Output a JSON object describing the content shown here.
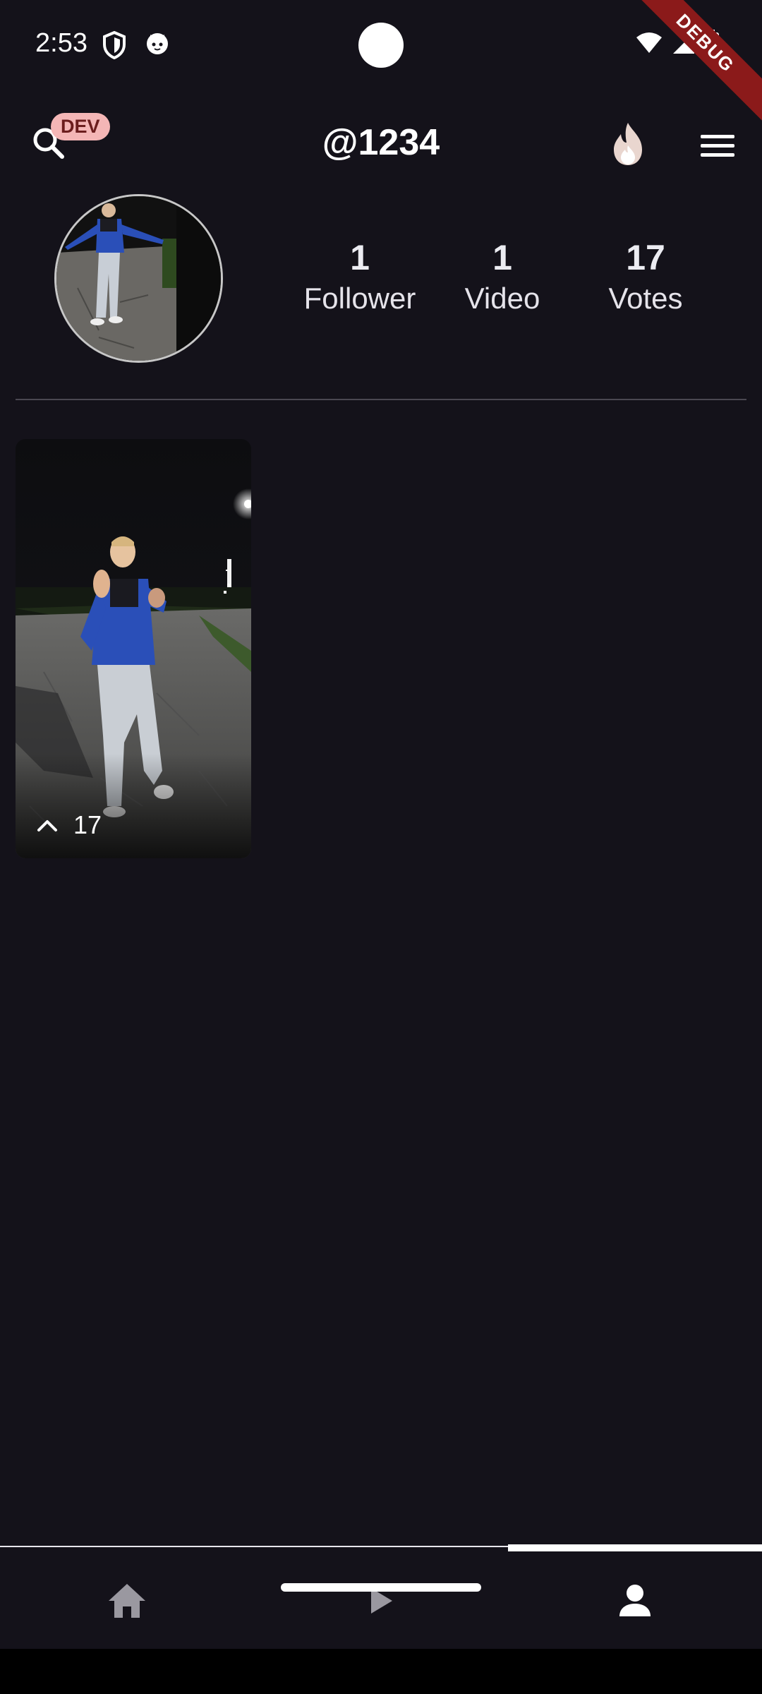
{
  "status_bar": {
    "time": "2:53"
  },
  "debug_banner": "DEBUG",
  "header": {
    "dev_badge": "DEV",
    "title": "@1234"
  },
  "profile": {
    "stats": [
      {
        "value": "1",
        "label": "Follower"
      },
      {
        "value": "1",
        "label": "Video"
      },
      {
        "value": "17",
        "label": "Votes"
      }
    ]
  },
  "videos": [
    {
      "votes": "17"
    }
  ],
  "bottom_nav": {
    "items": [
      {
        "icon": "home-icon"
      },
      {
        "icon": "play-icon"
      },
      {
        "icon": "person-icon",
        "active": true
      }
    ]
  },
  "colors": {
    "background": "#14121a",
    "badge_bg": "#f4b6b6",
    "badge_text": "#6b1d1d",
    "debug_ribbon": "#8b1a1a",
    "jacket_blue": "#2a4fb8"
  }
}
